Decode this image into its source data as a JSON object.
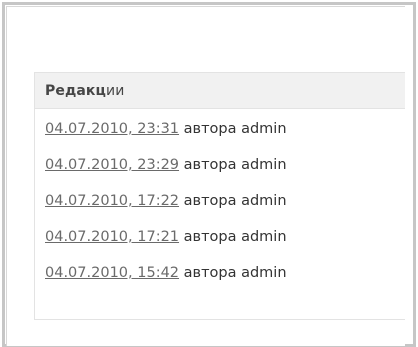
{
  "panel": {
    "title_bold": "Редакц",
    "title_rest": "ии"
  },
  "revisions": [
    {
      "date": "04.07.2010, 23:31",
      "author": " автора admin"
    },
    {
      "date": "04.07.2010, 23:29",
      "author": " автора admin"
    },
    {
      "date": "04.07.2010, 17:22",
      "author": " автора admin"
    },
    {
      "date": "04.07.2010, 17:21",
      "author": " автора admin"
    },
    {
      "date": "04.07.2010, 15:42",
      "author": " автора admin"
    }
  ],
  "colors": {
    "link": "#6a6a6a",
    "text": "#333333",
    "header_bg": "#f1f1f1",
    "frame": "#c6c6c6"
  }
}
